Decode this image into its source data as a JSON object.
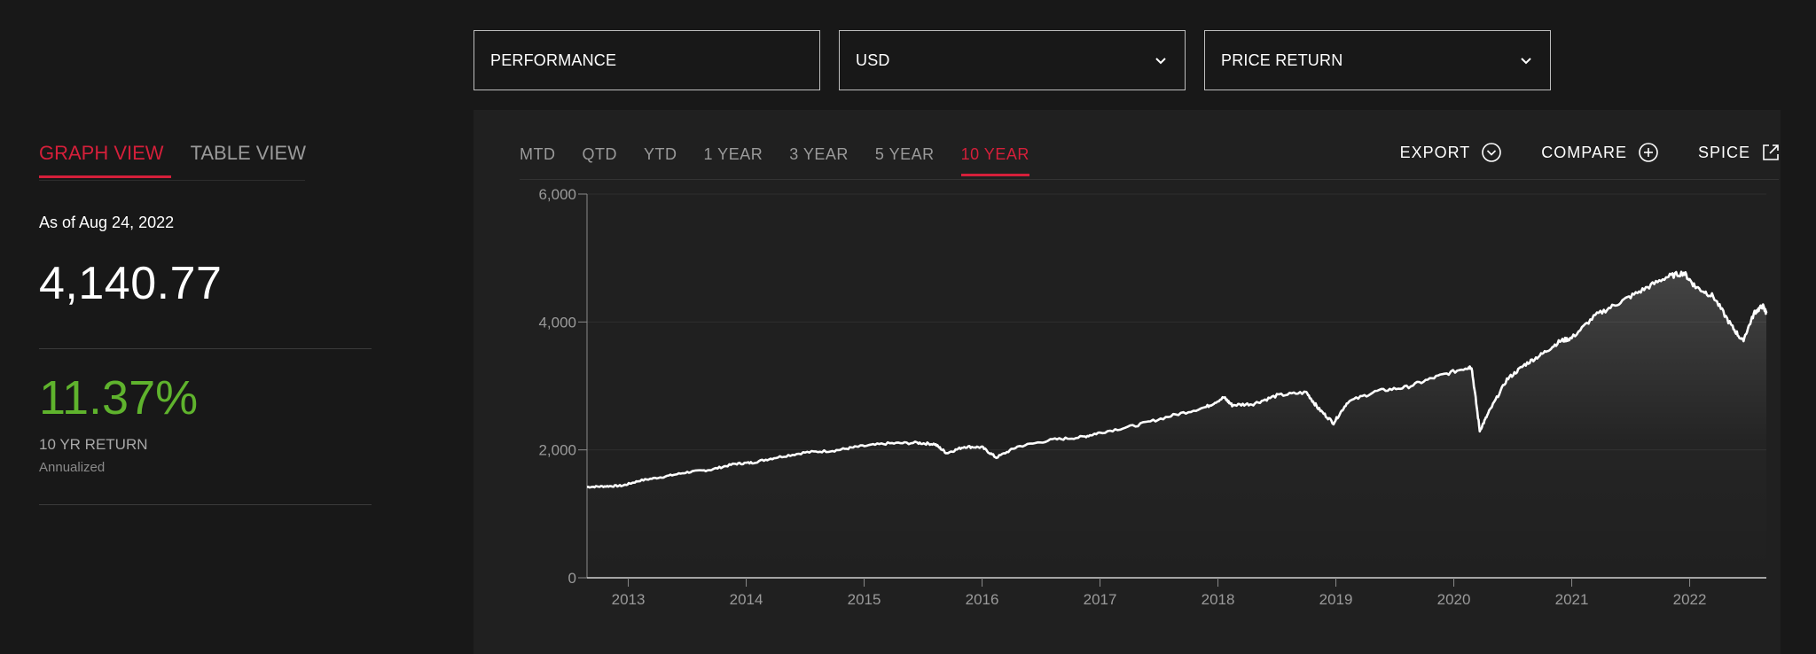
{
  "dropdowns": {
    "performance": "PERFORMANCE",
    "currency": "USD",
    "return_type": "PRICE RETURN"
  },
  "left": {
    "graph_view": "GRAPH VIEW",
    "table_view": "TABLE VIEW",
    "as_of": "As of Aug 24, 2022",
    "value": "4,140.77",
    "return_pct": "11.37%",
    "return_label": "10 YR RETURN",
    "return_sub": "Annualized"
  },
  "ranges": [
    "MTD",
    "QTD",
    "YTD",
    "1 YEAR",
    "3 YEAR",
    "5 YEAR",
    "10 YEAR"
  ],
  "active_range": "10 YEAR",
  "actions": {
    "export": "EXPORT",
    "compare": "COMPARE",
    "spice": "SPICE"
  },
  "colors": {
    "accent": "#d51f3a",
    "positive": "#5fb32d",
    "line": "#ffffff"
  },
  "chart_data": {
    "type": "area",
    "x_ticks": [
      "2013",
      "2014",
      "2015",
      "2016",
      "2017",
      "2018",
      "2019",
      "2020",
      "2021",
      "2022"
    ],
    "y_ticks": [
      "0",
      "2,000",
      "4,000",
      "6,000"
    ],
    "ylim": [
      0,
      6000
    ],
    "xlim": [
      2012.65,
      2022.65
    ],
    "series": [
      {
        "x": [
          2012.65,
          2012.8,
          2012.95,
          2013.1,
          2013.3,
          2013.5,
          2013.7,
          2013.9,
          2014.05,
          2014.25,
          2014.5,
          2014.75,
          2014.95,
          2015.2,
          2015.45,
          2015.6,
          2015.7,
          2015.85,
          2016.0,
          2016.12,
          2016.3,
          2016.6,
          2016.85,
          2017.0,
          2017.3,
          2017.6,
          2017.9,
          2018.05,
          2018.12,
          2018.3,
          2018.5,
          2018.75,
          2018.85,
          2018.98,
          2019.1,
          2019.35,
          2019.6,
          2019.85,
          2020.1,
          2020.15,
          2020.22,
          2020.3,
          2020.45,
          2020.6,
          2020.75,
          2020.9,
          2021.0,
          2021.2,
          2021.4,
          2021.6,
          2021.8,
          2021.95,
          2022.05,
          2022.2,
          2022.35,
          2022.45,
          2022.55,
          2022.62,
          2022.65
        ],
        "y": [
          1420,
          1430,
          1440,
          1520,
          1580,
          1650,
          1690,
          1780,
          1800,
          1880,
          1960,
          1990,
          2050,
          2100,
          2110,
          2090,
          1950,
          2050,
          2040,
          1880,
          2050,
          2160,
          2200,
          2270,
          2380,
          2530,
          2670,
          2820,
          2700,
          2720,
          2850,
          2900,
          2650,
          2420,
          2750,
          2920,
          2980,
          3140,
          3280,
          3300,
          2300,
          2600,
          3100,
          3330,
          3500,
          3700,
          3750,
          4100,
          4300,
          4500,
          4700,
          4770,
          4550,
          4400,
          3950,
          3700,
          4150,
          4250,
          4140
        ]
      }
    ]
  }
}
